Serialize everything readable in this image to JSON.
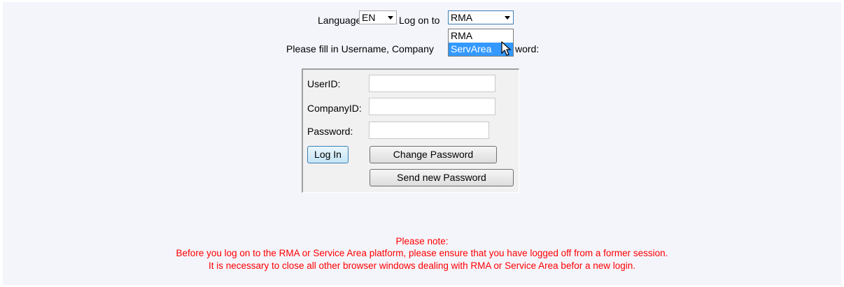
{
  "header": {
    "language_label": "Language:",
    "language_value": "EN",
    "logon_label": "Log on to",
    "logon_value": "RMA",
    "logon_options": [
      "RMA",
      "ServArea"
    ],
    "highlighted_option": "ServArea",
    "instruction": "Please fill in Username, CompanyID and Password:",
    "instruction_visible_start": "Please fill in Username, Company",
    "instruction_visible_end": "word:"
  },
  "form": {
    "userid_label": "UserID:",
    "userid_value": "",
    "companyid_label": "CompanyID:",
    "companyid_value": "",
    "password_label": "Password:",
    "password_value": "",
    "login_button": "Log In",
    "change_password_button": "Change Password",
    "send_password_button": "Send new Password"
  },
  "note": {
    "title": "Please note:",
    "line1": "Before you log on to the RMA or Service Area platform, please ensure that you have logged off from a former session.",
    "line2": "It is necessary to close all other browser windows dealing with RMA or Service Area befor a new login."
  },
  "colors": {
    "background": "#f4f5fb",
    "note_text": "#ff0000",
    "highlight": "#3399ff"
  }
}
